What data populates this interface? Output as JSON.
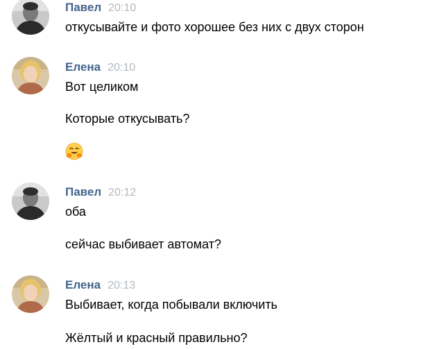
{
  "messages": [
    {
      "author": "Павел",
      "time": "20:10",
      "avatar": "pavel-avatar",
      "lines": [
        "откусывайте и фото хорошее без них с двух сторон"
      ]
    },
    {
      "author": "Елена",
      "time": "20:10",
      "avatar": "elena-avatar",
      "lines": [
        "Вот целиком",
        "Которые откусывать?"
      ],
      "emoji": "hugging-face-emoji"
    },
    {
      "author": "Павел",
      "time": "20:12",
      "avatar": "pavel-avatar",
      "lines": [
        "оба",
        "сейчас выбивает автомат?"
      ]
    },
    {
      "author": "Елена",
      "time": "20:13",
      "avatar": "elena-avatar",
      "lines": [
        "Выбивает, когда побывали включить",
        "Жёлтый и красный правильно?"
      ]
    }
  ],
  "colors": {
    "author": "#42648b",
    "time": "#b2b8c0",
    "text": "#000000",
    "background": "#ffffff"
  }
}
